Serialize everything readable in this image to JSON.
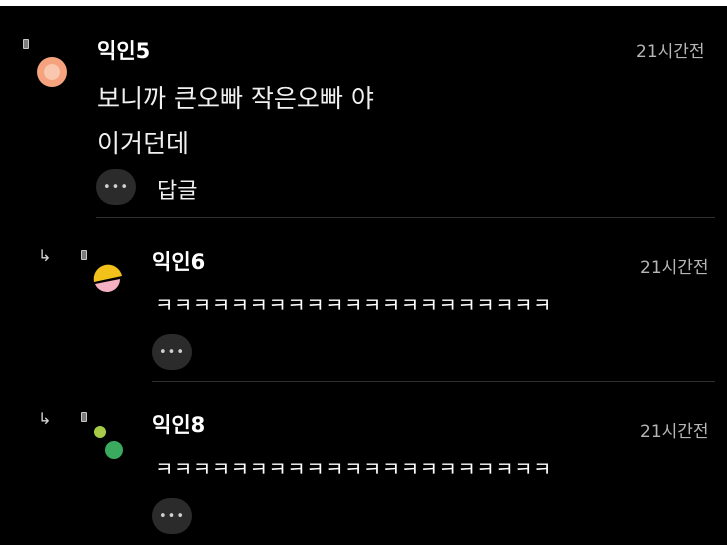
{
  "colors": {
    "background": "#000000",
    "avatar_comment5": "#f5a27f",
    "avatar_comment6_top": "#f2c21b",
    "avatar_comment6_bottom": "#f3b1c1",
    "avatar_comment8_small": "#a6cc47",
    "avatar_comment8_large": "#3aaa5f"
  },
  "comments": [
    {
      "username": "익인5",
      "time": "21시간전",
      "lines": [
        "보니까 큰오빠 작은오빠 야",
        "이거던데"
      ],
      "more_icon": "ellipsis-icon",
      "more_text": "•••",
      "reply_label": "답글"
    }
  ],
  "replies": [
    {
      "arrow_icon": "reply-arrow-icon",
      "arrow_text": "↳",
      "username": "익인6",
      "time": "21시간전",
      "text": "ㅋㅋㅋㅋㅋㅋㅋㅋㅋㅋㅋㅋㅋㅋㅋㅋㅋㅋㅋㅋㅋ",
      "more_icon": "ellipsis-icon",
      "more_text": "•••"
    },
    {
      "arrow_icon": "reply-arrow-icon",
      "arrow_text": "↳",
      "username": "익인8",
      "time": "21시간전",
      "text": "ㅋㅋㅋㅋㅋㅋㅋㅋㅋㅋㅋㅋㅋㅋㅋㅋㅋㅋㅋㅋㅋ",
      "more_icon": "ellipsis-icon",
      "more_text": "•••"
    }
  ]
}
